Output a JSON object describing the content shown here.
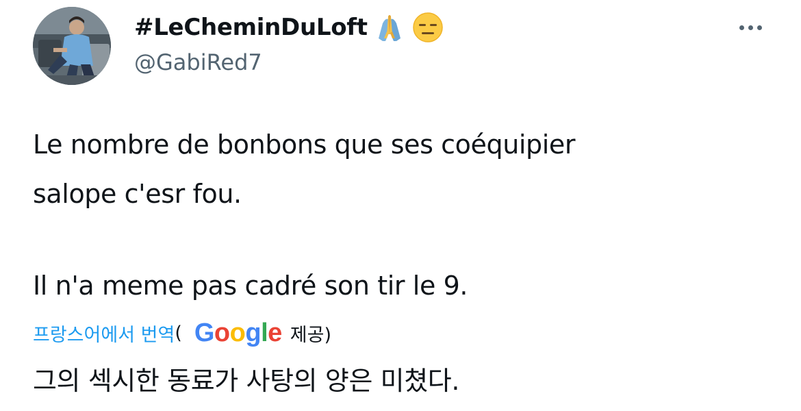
{
  "header": {
    "display_name": "#LeCheminDuLoft",
    "emojis": [
      "folded-hands-emoji",
      "expressionless-face-emoji"
    ],
    "handle": "@GabiRed7",
    "more_icon": "more-horizontal-icon"
  },
  "tweet": {
    "lines": [
      "Le nombre de bonbons que ses coéquipier",
      "salope c'esr fou.",
      "Il n'a meme pas cadré son tir le 9."
    ]
  },
  "translation": {
    "link_label": "프랑스어에서 번역",
    "open_paren": "(",
    "provider": {
      "letters": [
        "G",
        "o",
        "o",
        "g",
        "l",
        "e"
      ],
      "colors": [
        "#4285F4",
        "#EA4335",
        "#FBBC05",
        "#4285F4",
        "#34A853",
        "#EA4335"
      ]
    },
    "provided_suffix": "제공)",
    "text": "그의 섹시한 동료가 사탕의 양은 미쳤다."
  }
}
